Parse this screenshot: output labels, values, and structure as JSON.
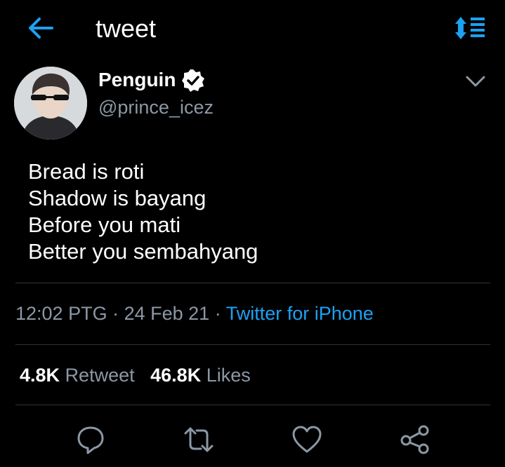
{
  "header": {
    "title": "tweet"
  },
  "tweet": {
    "name": "Penguin",
    "handle": "@prince_icez",
    "lines": [
      "Bread is roti",
      "Shadow is bayang",
      "Before you mati",
      "Better you sembahyang"
    ],
    "time": "12:02 PTG",
    "date": "24 Feb 21",
    "source": "Twitter for iPhone",
    "retweets": "4.8K",
    "retweet_label": "Retweet",
    "likes": "46.8K",
    "likes_label": "Likes"
  },
  "colors": {
    "accent": "#1da1f2",
    "muted": "#8b98a5",
    "background": "#000000"
  },
  "icons": [
    "back-arrow-icon",
    "sort-icon",
    "verified-icon",
    "chevron-down-icon",
    "reply-icon",
    "retweet-icon",
    "like-icon",
    "share-icon"
  ]
}
